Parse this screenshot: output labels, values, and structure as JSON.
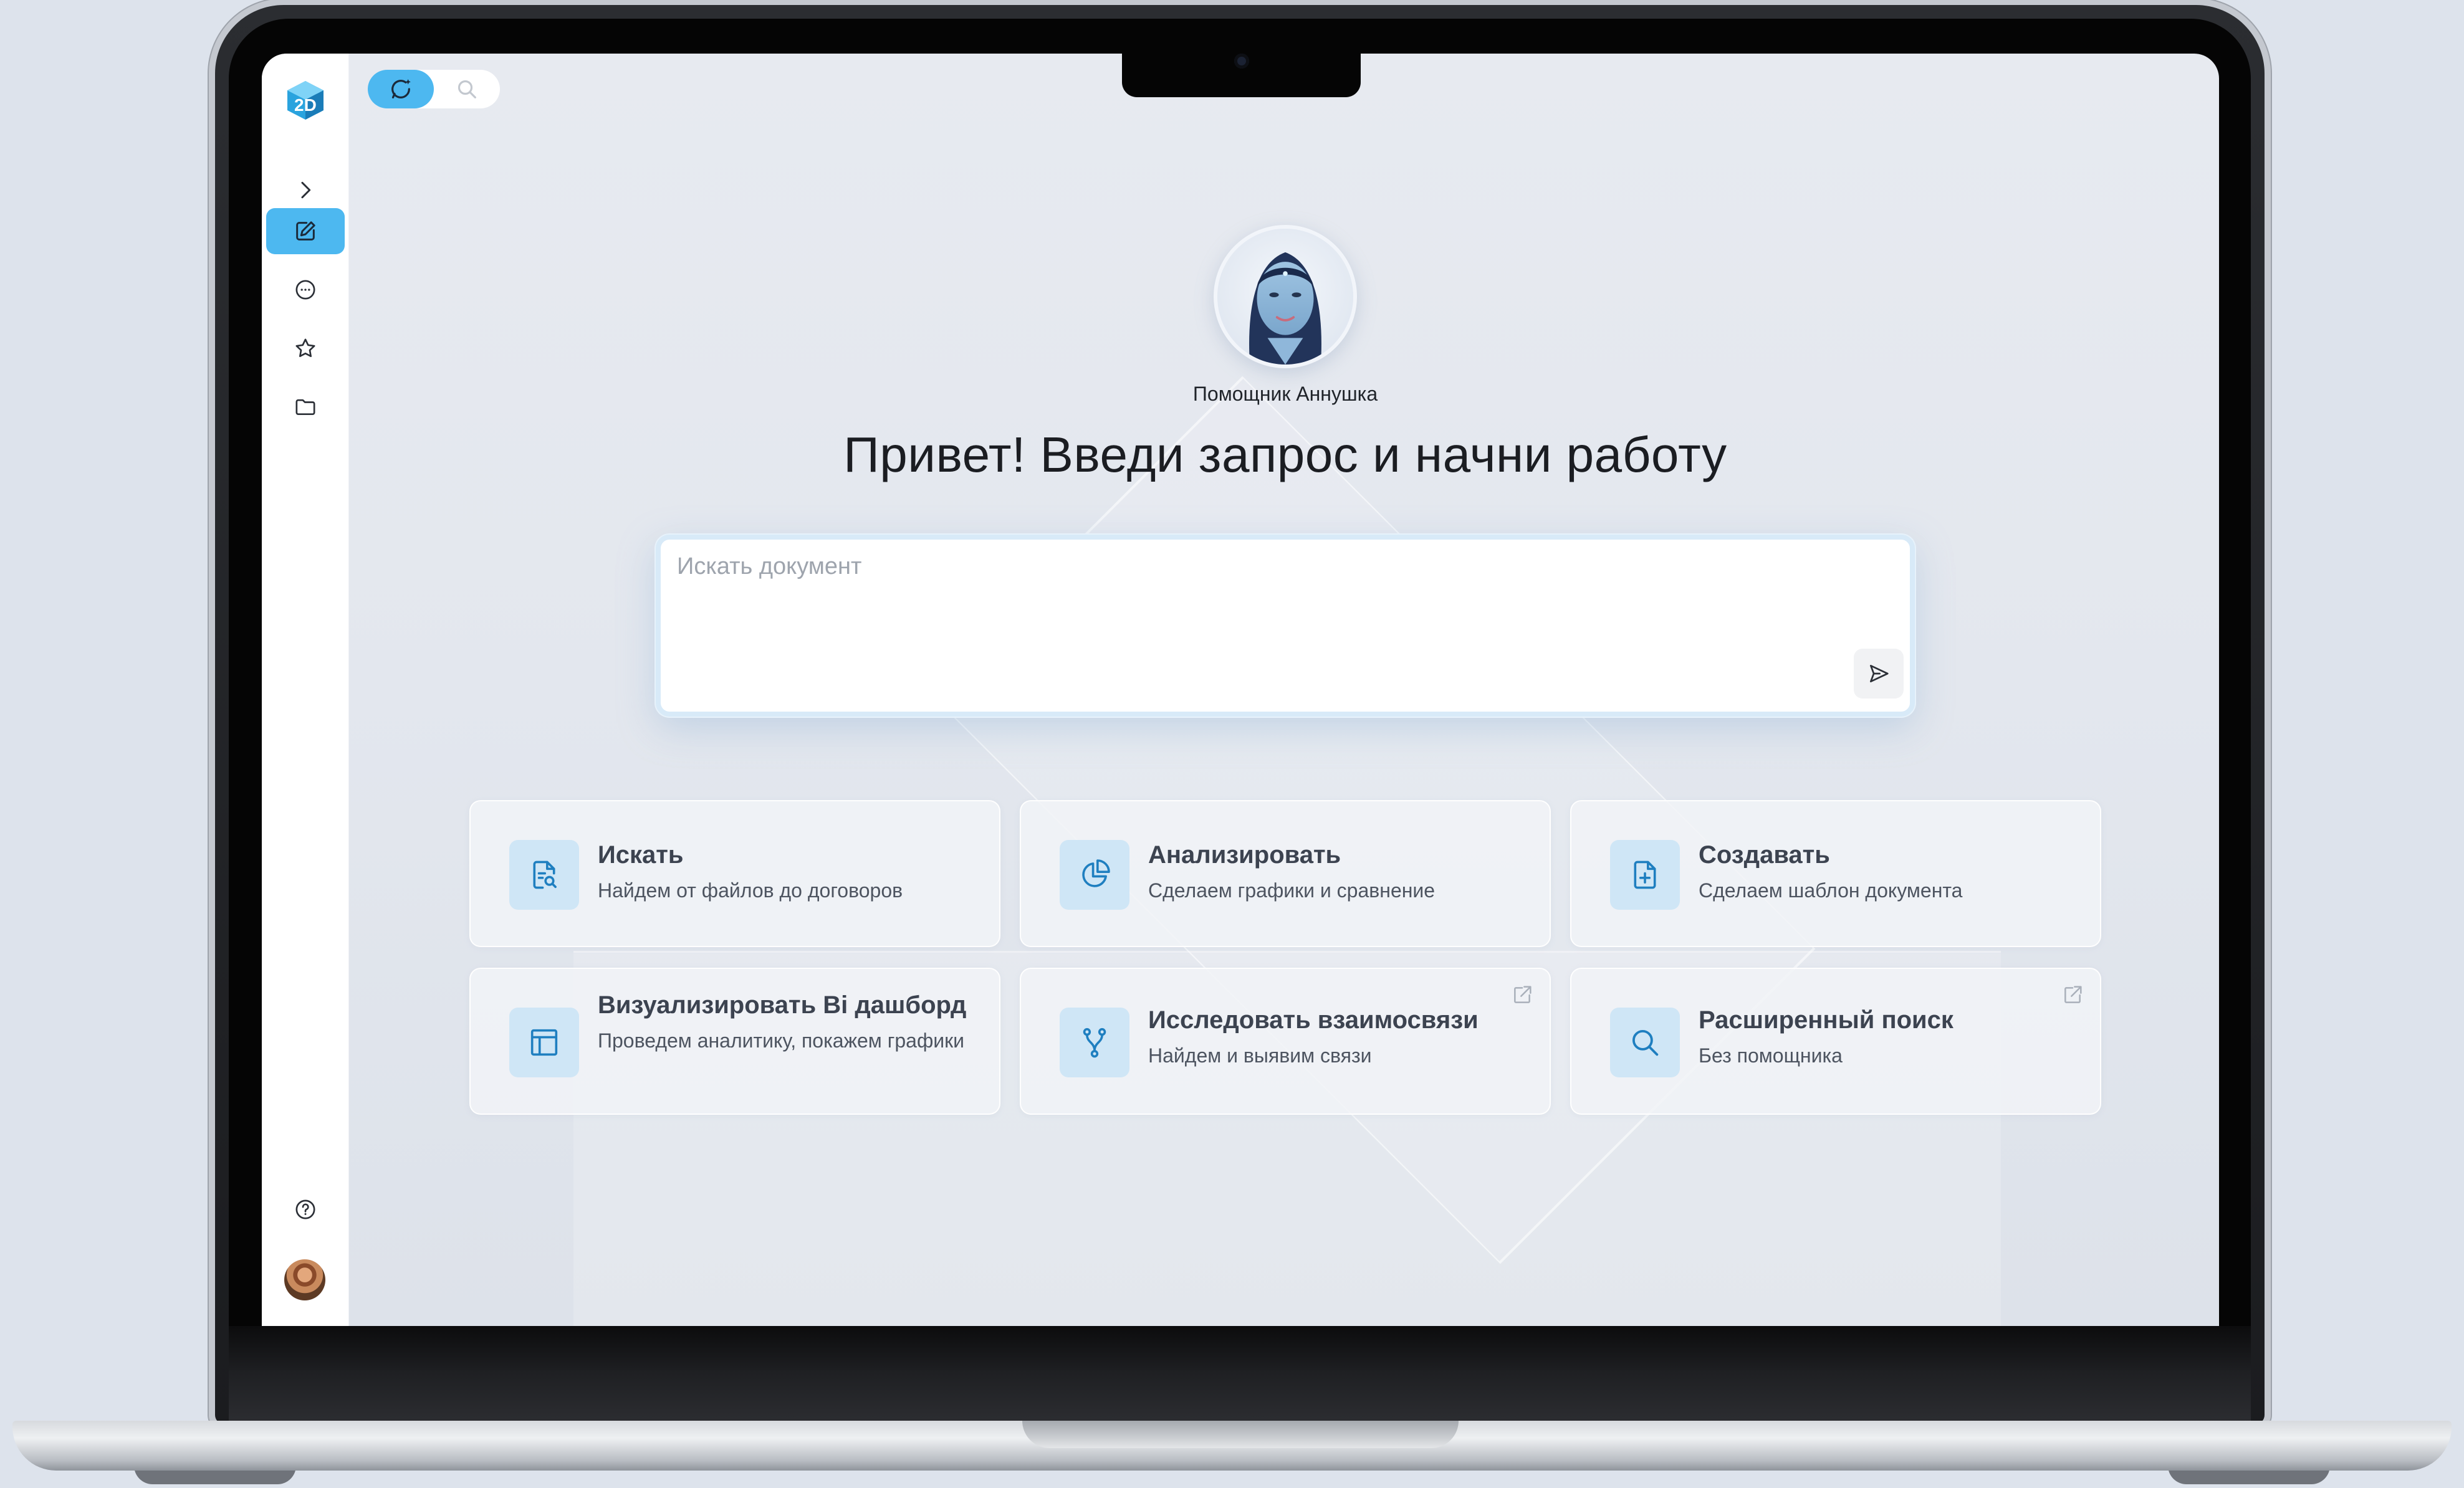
{
  "app": {
    "logo_icon": "2d-cube-logo-icon",
    "accent_color": "#4db8f0",
    "icon_color": "#1f7fc0"
  },
  "sidebar": {
    "items": [
      {
        "name": "expand",
        "icon": "chevron-right-icon"
      },
      {
        "name": "new-request",
        "icon": "edit-icon",
        "active": true
      },
      {
        "name": "chats",
        "icon": "chat-bubble-icon"
      },
      {
        "name": "favorites",
        "icon": "star-icon"
      },
      {
        "name": "documents",
        "icon": "folder-icon"
      }
    ],
    "bottom": [
      {
        "name": "help",
        "icon": "help-circle-icon"
      },
      {
        "name": "profile",
        "icon": "user-avatar"
      }
    ]
  },
  "mode_toggle": {
    "options": [
      {
        "name": "assistant",
        "icon": "ai-sparkle-chat-icon",
        "selected": true
      },
      {
        "name": "search",
        "icon": "search-icon",
        "selected": false
      }
    ]
  },
  "assistant": {
    "name": "Помощник Аннушка",
    "greeting": "Привет! Введи запрос и начни работу"
  },
  "prompt": {
    "placeholder": "Искать документ",
    "value": "",
    "send_icon": "send-icon"
  },
  "cards": [
    {
      "title": "Искать",
      "subtitle": "Найдем от файлов до договоров",
      "icon": "document-search-icon",
      "external": false
    },
    {
      "title": "Анализировать",
      "subtitle": "Сделаем графики и сравнение",
      "icon": "pie-chart-icon",
      "external": false
    },
    {
      "title": "Создавать",
      "subtitle": "Сделаем шаблон документа",
      "icon": "document-add-icon",
      "external": false
    },
    {
      "title": "Визуализировать Bi дашборд",
      "subtitle": "Проведем аналитику, покажем графики",
      "icon": "dashboard-layout-icon",
      "external": true
    },
    {
      "title": "Исследовать взаимосвязи",
      "subtitle": "Найдем и выявим связи",
      "icon": "branch-icon",
      "external": true
    },
    {
      "title": "Расширенный поиск",
      "subtitle": "Без помощника",
      "icon": "search-icon",
      "external": true
    }
  ]
}
